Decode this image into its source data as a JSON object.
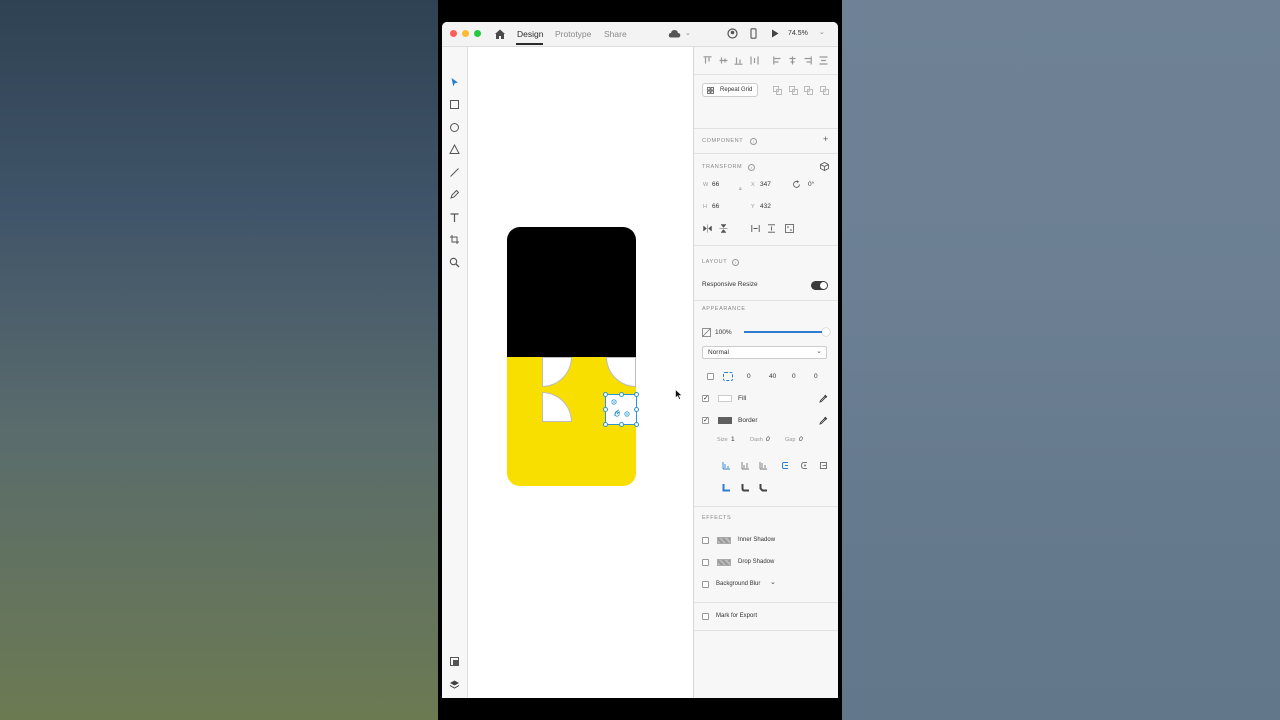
{
  "titlebar": {
    "tabs": [
      {
        "label": "Design",
        "active": true
      },
      {
        "label": "Prototype",
        "active": false
      },
      {
        "label": "Share",
        "active": false
      }
    ],
    "zoom": "74.5%"
  },
  "panel": {
    "repeat_grid_label": "Repeat Grid",
    "component": {
      "title": "COMPONENT",
      "add_icon": "+"
    },
    "transform": {
      "title": "TRANSFORM",
      "w_label": "W",
      "w_value": "66",
      "h_label": "H",
      "h_value": "66",
      "x_label": "X",
      "x_value": "347",
      "y_label": "Y",
      "y_value": "432",
      "rotation": "0°"
    },
    "layout": {
      "title": "LAYOUT",
      "responsive_resize": "Responsive Resize",
      "responsive_on": true
    },
    "appearance": {
      "title": "APPEARANCE",
      "opacity": "100%",
      "blend_mode": "Normal",
      "radius_values": [
        "0",
        "40",
        "0",
        "0"
      ],
      "fill_label": "Fill",
      "border_label": "Border",
      "size_label": "Size",
      "size_value": "1",
      "dash_label": "Dash",
      "dash_value": "0",
      "gap_label": "Gap",
      "gap_value": "0"
    },
    "effects": {
      "title": "EFFECTS",
      "inner_shadow": "Inner Shadow",
      "drop_shadow": "Drop Shadow",
      "background_blur": "Background Blur"
    },
    "export_label": "Mark for Export"
  },
  "colors": {
    "artboard_top": "#000000",
    "artboard_bottom": "#f8df00",
    "selection": "#2d96d2",
    "fill_swatch": "#ffffff",
    "border_swatch": "#5f5f5f"
  }
}
